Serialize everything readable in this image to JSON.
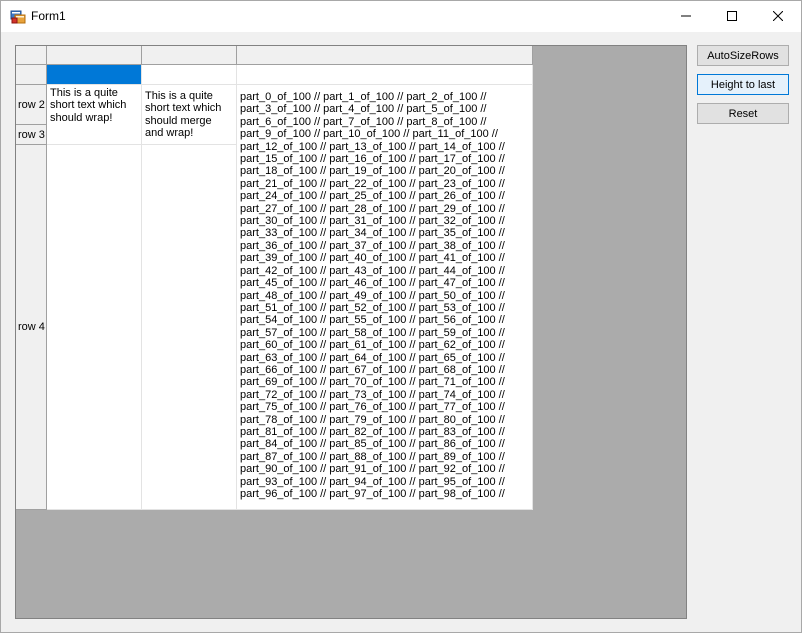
{
  "window": {
    "title": "Form1",
    "icons": {
      "app": "winforms-app-icon",
      "minimize": "minimize-icon",
      "maximize": "maximize-icon",
      "close": "close-icon"
    }
  },
  "grid": {
    "column_headers": [
      "",
      "",
      ""
    ],
    "rows": [
      {
        "header": "",
        "cells": [
          "",
          "",
          ""
        ],
        "selected_cell": 0
      },
      {
        "header": "row 2",
        "cells": [
          "This is a quite short text which should wrap!",
          "This is a quite short text which should merge and wrap!",
          "part_0_of_100 // part_1_of_100 // part_2_of_100 // part_3_of_100 // part_4_of_100 // part_5_of_100 // part_6_of_100 // part_7_of_100 // part_8_of_100 // part_9_of_100 // part_10_of_100 // part_11_of_100 // part_12_of_100 // part_13_of_100 // part_14_of_100 // part_15_of_100 // part_16_of_100 // part_17_of_100 // part_18_of_100 // part_19_of_100 // part_20_of_100 // part_21_of_100 // part_22_of_100 // part_23_of_100 // part_24_of_100 // part_25_of_100 // part_26_of_100 // part_27_of_100 // part_28_of_100 // part_29_of_100 // part_30_of_100 // part_31_of_100 // part_32_of_100 // part_33_of_100 // part_34_of_100 // part_35_of_100 // part_36_of_100 // part_37_of_100 // part_38_of_100 // part_39_of_100 // part_40_of_100 // part_41_of_100 // part_42_of_100 // part_43_of_100 // part_44_of_100 // part_45_of_100 // part_46_of_100 // part_47_of_100 // part_48_of_100 // part_49_of_100 // part_50_of_100 // part_51_of_100 // part_52_of_100 // part_53_of_100 // part_54_of_100 // part_55_of_100 // part_56_of_100 // part_57_of_100 // part_58_of_100 // part_59_of_100 // part_60_of_100 // part_61_of_100 // part_62_of_100 // part_63_of_100 // part_64_of_100 // part_65_of_100 // part_66_of_100 // part_67_of_100 // part_68_of_100 // part_69_of_100 // part_70_of_100 // part_71_of_100 // part_72_of_100 // part_73_of_100 // part_74_of_100 // part_75_of_100 // part_76_of_100 // part_77_of_100 // part_78_of_100 // part_79_of_100 // part_80_of_100 // part_81_of_100 // part_82_of_100 // part_83_of_100 // part_84_of_100 // part_85_of_100 // part_86_of_100 // part_87_of_100 // part_88_of_100 // part_89_of_100 // part_90_of_100 // part_91_of_100 // part_92_of_100 // part_93_of_100 // part_94_of_100 // part_95_of_100 // part_96_of_100 // part_97_of_100 // part_98_of_100 //"
        ]
      },
      {
        "header": "row 3",
        "cells": [
          "",
          "",
          ""
        ]
      },
      {
        "header": "row 4",
        "cells": [
          "",
          "",
          ""
        ]
      }
    ]
  },
  "buttons": {
    "autosize_rows": "AutoSizeRows",
    "height_to_last": "Height to last",
    "reset": "Reset"
  },
  "colors": {
    "selection": "#0078d7",
    "grid_background": "#ababab",
    "focused_button_border": "#0078d7"
  }
}
